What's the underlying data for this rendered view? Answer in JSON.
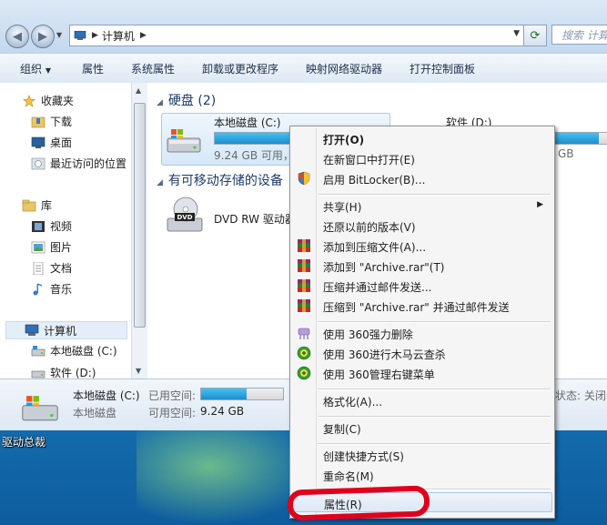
{
  "desktop": {
    "label": "驱动总裁"
  },
  "address": {
    "segment": "计算机",
    "search_placeholder": "搜索 计算"
  },
  "toolbar": {
    "items": [
      "组织",
      "属性",
      "系统属性",
      "卸载或更改程序",
      "映射网络驱动器",
      "打开控制面板"
    ]
  },
  "nav": {
    "favorites": "收藏夹",
    "downloads": "下载",
    "desktop": "桌面",
    "recent": "最近访问的位置",
    "libraries": "库",
    "videos": "视频",
    "pictures": "图片",
    "documents": "文档",
    "music": "音乐",
    "computer": "计算机",
    "local_disk": "本地磁盘 (C:)",
    "software": "软件 (D:)"
  },
  "content": {
    "hard_drives_group": "硬盘 (2)",
    "removable_group": "有可移动存储的设备",
    "drive_c_name": "本地磁盘 (C:)",
    "drive_c_free": "9.24 GB 可用，",
    "drive_c_used_fraction": 0.55,
    "drive_d_name": "软件 (D:)",
    "drive_d_free": "GB",
    "drive_d_used_fraction": 0.95,
    "dvd_name": "DVD RW 驱动器"
  },
  "details": {
    "name": "本地磁盘 (C:)",
    "type": "本地磁盘",
    "used_label": "已用空间:",
    "free_label": "可用空间:",
    "free_value": "9.24 GB",
    "status": "状态: 关闭"
  },
  "menu": {
    "items": {
      "open": "打开(O)",
      "open_new": "在新窗口中打开(E)",
      "bitlocker": "启用 BitLocker(B)...",
      "share": "共享(H)",
      "restore": "还原以前的版本(V)",
      "add_archive": "添加到压缩文件(A)...",
      "add_rar": "添加到 \"Archive.rar\"(T)",
      "compress_email": "压缩并通过邮件发送...",
      "compress_rar_email": "压缩到 \"Archive.rar\" 并通过邮件发送",
      "force_delete": "使用 360强力删除",
      "trojan_scan": "使用 360进行木马云查杀",
      "manage_menu": "使用 360管理右键菜单",
      "format": "格式化(A)...",
      "copy": "复制(C)",
      "shortcut": "创建快捷方式(S)",
      "rename": "重命名(M)",
      "properties": "属性(R)"
    }
  },
  "colors": {
    "accent": "#1a8fd0",
    "highlight_mark": "#e0001b",
    "group_heading": "#1e3a6b"
  }
}
